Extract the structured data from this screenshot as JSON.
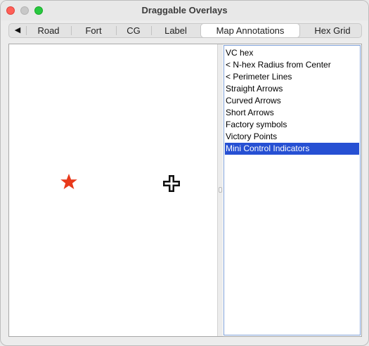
{
  "window": {
    "title": "Draggable Overlays"
  },
  "tabs": {
    "scroll_left_icon": "◀",
    "items": [
      {
        "label": "Road"
      },
      {
        "label": "Fort"
      },
      {
        "label": "CG"
      },
      {
        "label": "Label"
      },
      {
        "label": "Map Annotations",
        "selected": true
      },
      {
        "label": "Hex Grid"
      }
    ]
  },
  "preview": {
    "icons": [
      "red-star-icon",
      "black-cross-icon"
    ],
    "colors": {
      "star": "#e8391b",
      "cross": "#111111"
    }
  },
  "list": {
    "items": [
      {
        "label": "VC hex"
      },
      {
        "label": "< N-hex Radius from Center"
      },
      {
        "label": "< Perimeter Lines"
      },
      {
        "label": "Straight Arrows"
      },
      {
        "label": "Curved Arrows"
      },
      {
        "label": "Short Arrows"
      },
      {
        "label": "Factory symbols"
      },
      {
        "label": "Victory Points"
      },
      {
        "label": "Mini Control Indicators",
        "selected": true
      }
    ],
    "selection_color": "#2650d3"
  }
}
